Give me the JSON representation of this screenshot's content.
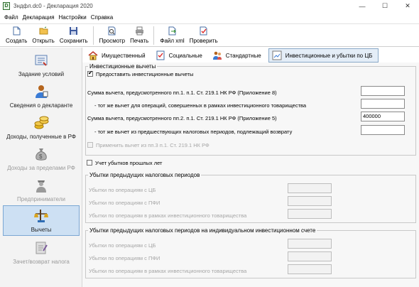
{
  "window": {
    "title": "3ндфл.dc0 - Декларация 2020",
    "minimize": "—",
    "maximize": "☐",
    "close": "✕"
  },
  "menu": [
    "Файл",
    "Декларация",
    "Настройки",
    "Справка"
  ],
  "toolbar": {
    "create": "Создать",
    "open": "Открыть",
    "save": "Сохранить",
    "preview": "Просмотр",
    "print": "Печать",
    "xml": "Файл xml",
    "check": "Проверить"
  },
  "sidebar": [
    {
      "label": "Задание условий",
      "icon": "settings-icon",
      "state": "normal"
    },
    {
      "label": "Сведения о декларанте",
      "icon": "person-icon",
      "state": "normal"
    },
    {
      "label": "Доходы, полученные в РФ",
      "icon": "coins-icon",
      "state": "normal"
    },
    {
      "label": "Доходы за пределами РФ",
      "icon": "money-bag-icon",
      "state": "disabled"
    },
    {
      "label": "Предприниматели",
      "icon": "businessman-icon",
      "state": "disabled"
    },
    {
      "label": "Вычеты",
      "icon": "deductions-icon",
      "state": "active"
    },
    {
      "label": "Зачет/возврат налога",
      "icon": "document-icon",
      "state": "disabled"
    }
  ],
  "tabs": [
    {
      "label": "Имущественный",
      "icon": "house-icon"
    },
    {
      "label": "Социальные",
      "icon": "checklist-icon"
    },
    {
      "label": "Стандартные",
      "icon": "people-icon"
    },
    {
      "label": "Инвестиционные и убытки по ЦБ",
      "icon": "investment-icon",
      "active": true
    }
  ],
  "investment": {
    "group_title": "Инвестиционные вычеты",
    "provide_label": "Предоставить инвестиционные вычеты",
    "provide_checked": true,
    "row1": "Сумма вычета, предусмотренного пп.1. п.1. Ст. 219.1 НК РФ (Приложение 8)",
    "row2": "- тот же вычет для операций, совершенных в рамках инвестиционного товарищества",
    "row3": "Сумма вычета, предусмотренного пп.2. п.1. Ст. 219.1 НК РФ (Приложение 5)",
    "row3_value": "400000",
    "row4": "- тот же вычет из предшествующих налоговых периодов, подлежащий возврату",
    "row5": "Применить вычет из пп.3 п.1. Ст. 219.1 НК РФ"
  },
  "losses": {
    "checkbox_label": "Учет убытков прошлых лет",
    "sub1_title": "Убытки предыдущих налоговых периодов",
    "sub1_rows": [
      "Убытки по операциям с ЦБ",
      "Убытки по операциям с ПФИ",
      "Убытки по операциям в рамках инвестиционного товарищества"
    ],
    "sub2_title": "Убытки предыдущих налоговых периодов на индивидуальном инвестиционном счете",
    "sub2_rows": [
      "Убытки по операциям с ЦБ",
      "Убытки по операциям с ПФИ",
      "Убытки по операциям в рамках инвестиционного товарищества"
    ]
  }
}
